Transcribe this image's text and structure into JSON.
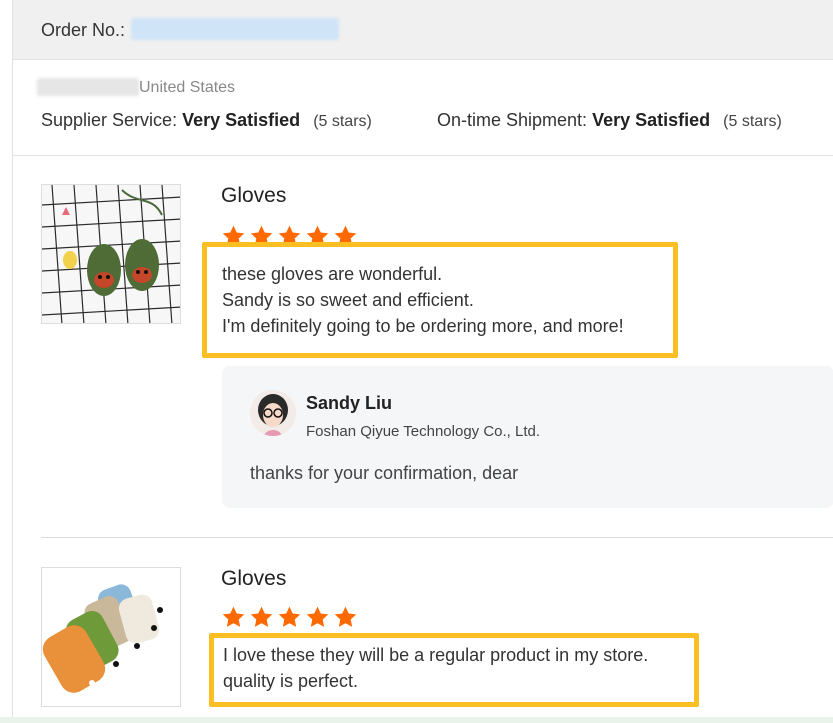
{
  "order": {
    "label": "Order No.:"
  },
  "buyer": {
    "country": "United States",
    "supplier_service_label": "Supplier Service:",
    "supplier_service_value": "Very Satisfied",
    "supplier_service_stars": "(5 stars)",
    "shipment_label": "On-time Shipment:",
    "shipment_value": "Very Satisfied",
    "shipment_stars": "(5 stars)"
  },
  "reviews": [
    {
      "product_title": "Gloves",
      "rating": 5,
      "comment": "these gloves are wonderful.\nSandy is so sweet and efficient.\nI'm definitely going to be ordering more, and more!",
      "reply": {
        "name": "Sandy Liu",
        "company": "Foshan Qiyue Technology Co., Ltd.",
        "text": "thanks for your confirmation, dear"
      }
    },
    {
      "product_title": "Gloves",
      "rating": 5,
      "comment": "I love these they will be a regular product in my store.\nquality is perfect."
    }
  ],
  "colors": {
    "star": "#ff6a00",
    "highlight_border": "#fbbf24",
    "reply_bg": "#f5f6f8",
    "order_bar_bg": "#f0f0f0"
  },
  "icons": {
    "star": "star-icon",
    "avatar": "supplier-avatar"
  }
}
